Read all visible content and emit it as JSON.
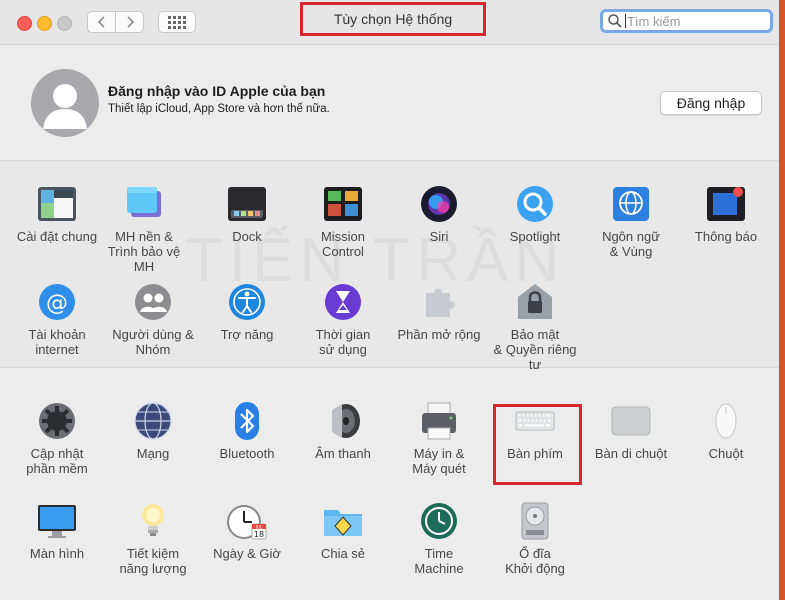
{
  "window": {
    "title": "Tùy chọn Hệ thống",
    "search_placeholder": "Tìm kiếm"
  },
  "account": {
    "title": "Đăng nhập vào ID Apple của bạn",
    "subtitle": "Thiết lập iCloud, App Store và hơn thế nữa.",
    "signin_label": "Đăng nhập"
  },
  "watermark": "TIẾN TRẦN",
  "row1": [
    {
      "label": "Cài đặt chung",
      "icon": "general-icon"
    },
    {
      "label": "MH nền &\nTrình bảo vệ MH",
      "icon": "desktop-screensaver-icon"
    },
    {
      "label": "Dock",
      "icon": "dock-icon"
    },
    {
      "label": "Mission\nControl",
      "icon": "mission-control-icon"
    },
    {
      "label": "Siri",
      "icon": "siri-icon"
    },
    {
      "label": "Spotlight",
      "icon": "spotlight-icon"
    },
    {
      "label": "Ngôn ngữ\n& Vùng",
      "icon": "language-region-icon"
    },
    {
      "label": "Thông báo",
      "icon": "notifications-icon"
    }
  ],
  "row2": [
    {
      "label": "Tài khoản\ninternet",
      "icon": "internet-accounts-icon"
    },
    {
      "label": "Người dùng &\nNhóm",
      "icon": "users-groups-icon"
    },
    {
      "label": "Trợ năng",
      "icon": "accessibility-icon"
    },
    {
      "label": "Thời gian\nsử dụng",
      "icon": "screen-time-icon"
    },
    {
      "label": "Phần mở rộng",
      "icon": "extensions-icon"
    },
    {
      "label": "Bảo mật\n& Quyền riêng tư",
      "icon": "security-privacy-icon"
    }
  ],
  "row3": [
    {
      "label": "Cập nhật\nphần mềm",
      "icon": "software-update-icon"
    },
    {
      "label": "Mạng",
      "icon": "network-icon"
    },
    {
      "label": "Bluetooth",
      "icon": "bluetooth-icon"
    },
    {
      "label": "Âm thanh",
      "icon": "sound-icon"
    },
    {
      "label": "Máy in &\nMáy quét",
      "icon": "printers-scanners-icon"
    },
    {
      "label": "Bàn phím",
      "icon": "keyboard-icon"
    },
    {
      "label": "Bàn di chuột",
      "icon": "trackpad-icon"
    },
    {
      "label": "Chuột",
      "icon": "mouse-icon"
    }
  ],
  "row4": [
    {
      "label": "Màn hình",
      "icon": "displays-icon"
    },
    {
      "label": "Tiết kiệm\nnăng lượng",
      "icon": "energy-saver-icon"
    },
    {
      "label": "Ngày & Giờ",
      "icon": "date-time-icon"
    },
    {
      "label": "Chia sẻ",
      "icon": "sharing-icon"
    },
    {
      "label": "Time\nMachine",
      "icon": "time-machine-icon"
    },
    {
      "label": "Ổ đĩa\nKhởi động",
      "icon": "startup-disk-icon"
    }
  ],
  "date_icon_text": {
    "month": "JUL",
    "day": "18"
  }
}
